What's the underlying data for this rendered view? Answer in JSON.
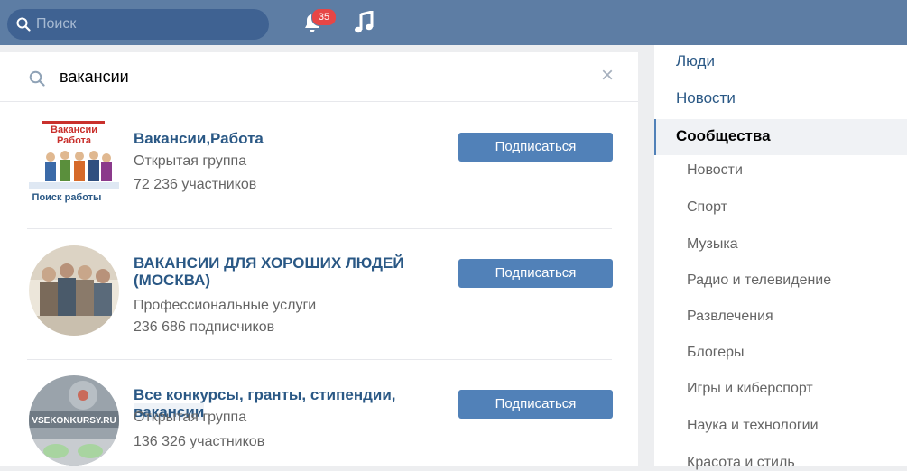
{
  "header": {
    "search_placeholder": "Поиск",
    "notifications_badge": "35"
  },
  "search": {
    "query": "вакансии"
  },
  "results": [
    {
      "avatar_lines": [
        "Вакансии",
        "Работа",
        "Поиск работы"
      ],
      "title": "Вакансии,Работа",
      "type": "Открытая группа",
      "members": "72 236 участников",
      "button": "Подписаться"
    },
    {
      "title_line1": "ВАКАНСИИ ДЛЯ ХОРОШИХ ЛЮДЕЙ",
      "title_line2": "(МОСКВА)",
      "type": "Профессиональные услуги",
      "members": "236 686 подписчиков",
      "button": "Подписаться"
    },
    {
      "avatar_text": "VSEKONKURSY.RU",
      "title_plain": "Все конкурсы, гранты, стипендии, ",
      "title_highlight": "вакансии",
      "type": "Открытая группа",
      "members": "136 326 участников",
      "button": "Подписаться"
    }
  ],
  "sidebar": {
    "top_items": [
      "Люди",
      "Новости"
    ],
    "active": "Сообщества",
    "sub_items": [
      "Новости",
      "Спорт",
      "Музыка",
      "Радио и телевидение",
      "Развлечения",
      "Блогеры",
      "Игры и киберспорт",
      "Наука и технологии",
      "Красота и стиль"
    ]
  },
  "colors": {
    "header": "#5d7da4",
    "button": "#5181b8",
    "link": "#2a5885",
    "badge": "#e64646"
  }
}
